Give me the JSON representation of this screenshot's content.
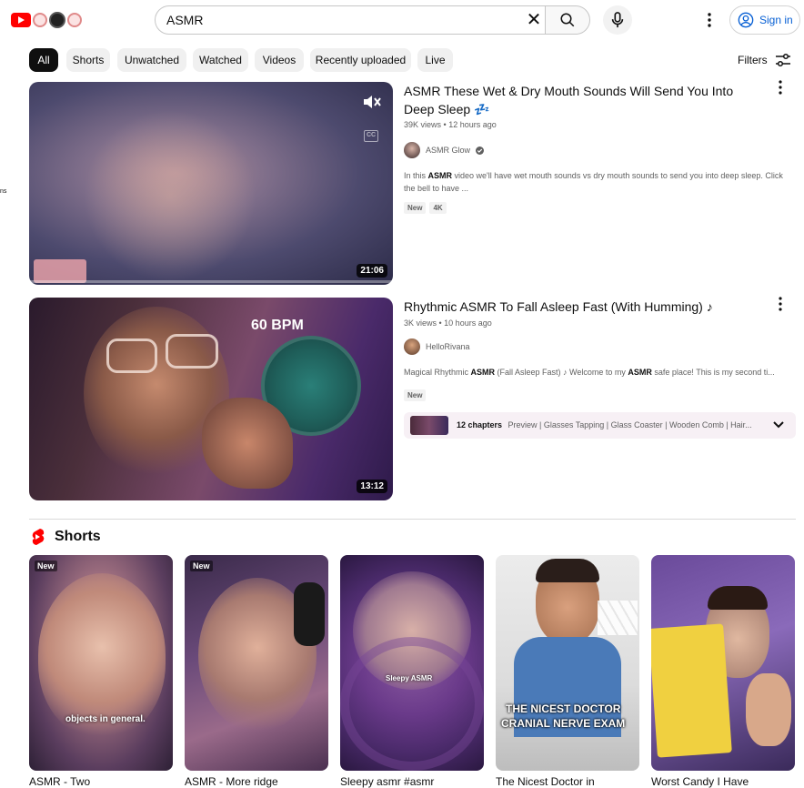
{
  "header": {
    "search_value": "ASMR",
    "signin_label": "Sign in"
  },
  "chips": [
    "All",
    "Shorts",
    "Unwatched",
    "Watched",
    "Videos",
    "Recently uploaded",
    "Live"
  ],
  "filters_label": "Filters",
  "side_fragment": "ns",
  "videos": [
    {
      "title": "ASMR These Wet & Dry Mouth Sounds Will Send You Into Deep Sleep 💤",
      "views": "39K views",
      "age": "12 hours ago",
      "channel": "ASMR Glow",
      "desc_pre": "In this ",
      "desc_bold": "ASMR",
      "desc_post": " video we'll have wet mouth sounds vs dry mouth sounds to send you into deep sleep. Click the bell to have ...",
      "badges": [
        "New",
        "4K"
      ],
      "duration": "21:06",
      "cc_label": "CC"
    },
    {
      "title": "Rhythmic ASMR To Fall Asleep Fast (With Humming) ♪",
      "views": "3K views",
      "age": "10 hours ago",
      "channel": "HelloRivana",
      "desc_pre": "Magical Rhythmic ",
      "desc_bold": "ASMR",
      "desc_mid": " (Fall Asleep Fast) ♪ Welcome to my ",
      "desc_bold2": "ASMR",
      "desc_post": " safe place! This is my second ti...",
      "badges": [
        "New"
      ],
      "duration": "13:12",
      "overlay_text": "60 BPM",
      "chapters_count": "12 chapters",
      "chapters_list": "Preview | Glasses Tapping | Glass Coaster | Wooden Comb | Hair..."
    }
  ],
  "shorts_section": {
    "heading": "Shorts",
    "items": [
      {
        "title": "ASMR - Two",
        "tag": "New",
        "caption": "objects in general."
      },
      {
        "title": "ASMR - More ridge",
        "tag": "New",
        "caption": ""
      },
      {
        "title": "Sleepy asmr #asmr",
        "tag": "",
        "caption": "Sleepy ASMR"
      },
      {
        "title": "The Nicest Doctor in",
        "tag": "",
        "caption_line1": "THE NICEST DOCTOR",
        "caption_line2": "CRANIAL NERVE EXAM"
      },
      {
        "title": "Worst Candy I Have",
        "tag": "",
        "caption": ""
      }
    ]
  },
  "colors": {
    "brand_red": "#ff0000",
    "link_blue": "#065fd4",
    "chip_active": "#0f0f0f",
    "chip_bg": "#f0f0f0"
  }
}
